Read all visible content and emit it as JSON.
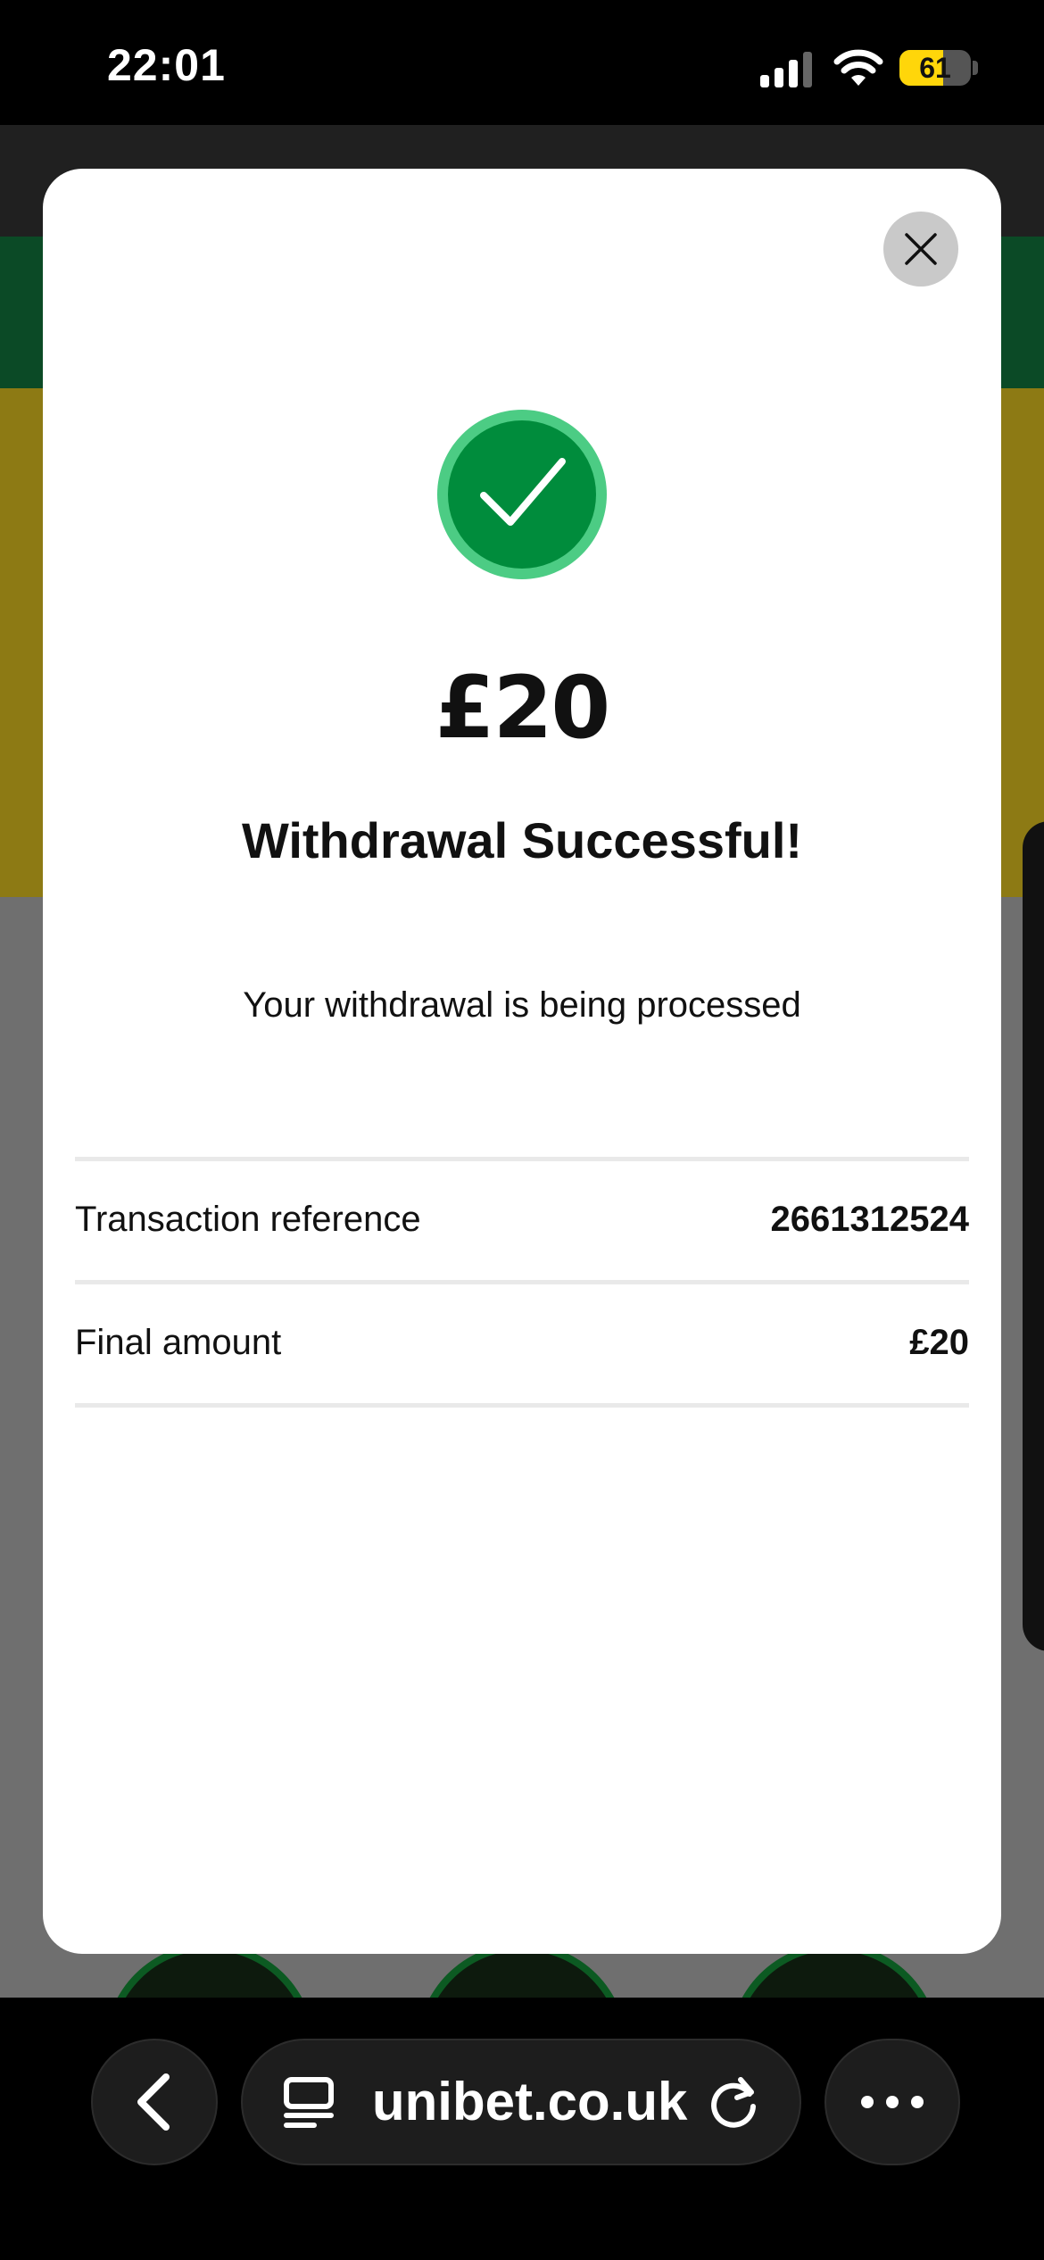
{
  "status_bar": {
    "time": "22:01",
    "battery_level": "61",
    "battery_fraction": 0.61,
    "icons": [
      "signal-icon",
      "wifi-icon",
      "battery-icon"
    ]
  },
  "modal": {
    "amount": "£20",
    "title": "Withdrawal Successful!",
    "subtitle": "Your withdrawal is being processed",
    "details": [
      {
        "label": "Transaction reference",
        "value": "2661312524"
      },
      {
        "label": "Final amount",
        "value": "£20"
      }
    ],
    "icons": [
      "close-icon",
      "check-circle-icon"
    ]
  },
  "browser": {
    "url": "unibet.co.uk",
    "icons": [
      "chevron-left-icon",
      "tabs-icon",
      "reload-icon",
      "more-icon"
    ]
  },
  "colors": {
    "success_green": "#008c3c",
    "success_ring": "#4ccc84",
    "battery_yellow": "#ffd60a"
  }
}
